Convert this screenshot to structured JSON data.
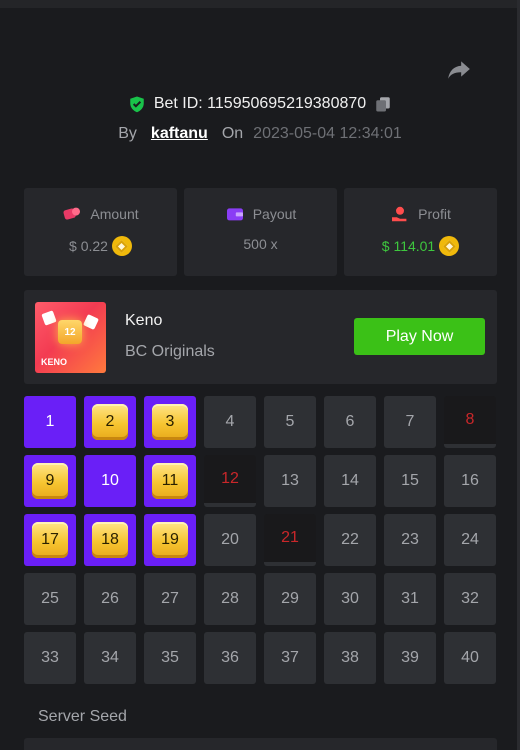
{
  "bet": {
    "id_label": "Bet ID: 115950695219380870",
    "by_label": "By",
    "username": "kaftanu",
    "on_label": "On",
    "datetime": "2023-05-04 12:34:01"
  },
  "stats": {
    "amount": {
      "label": "Amount",
      "value": "$ 0.22",
      "icon": "money-bag-icon"
    },
    "payout": {
      "label": "Payout",
      "value": "500 x",
      "icon": "wallet-icon"
    },
    "profit": {
      "label": "Profit",
      "value": "$ 114.01",
      "icon": "hand-coin-icon"
    }
  },
  "game": {
    "name": "Keno",
    "provider": "BC Originals",
    "thumb_label": "KENO",
    "thumb_number": "12",
    "play_label": "Play Now"
  },
  "grid": {
    "cells": [
      {
        "n": "1",
        "state": "sel"
      },
      {
        "n": "2",
        "state": "hit"
      },
      {
        "n": "3",
        "state": "hit"
      },
      {
        "n": "4",
        "state": "none"
      },
      {
        "n": "5",
        "state": "none"
      },
      {
        "n": "6",
        "state": "none"
      },
      {
        "n": "7",
        "state": "none"
      },
      {
        "n": "8",
        "state": "miss"
      },
      {
        "n": "9",
        "state": "hit"
      },
      {
        "n": "10",
        "state": "sel"
      },
      {
        "n": "11",
        "state": "hit"
      },
      {
        "n": "12",
        "state": "miss"
      },
      {
        "n": "13",
        "state": "none"
      },
      {
        "n": "14",
        "state": "none"
      },
      {
        "n": "15",
        "state": "none"
      },
      {
        "n": "16",
        "state": "none"
      },
      {
        "n": "17",
        "state": "hit"
      },
      {
        "n": "18",
        "state": "hit"
      },
      {
        "n": "19",
        "state": "hit"
      },
      {
        "n": "20",
        "state": "none"
      },
      {
        "n": "21",
        "state": "miss"
      },
      {
        "n": "22",
        "state": "none"
      },
      {
        "n": "23",
        "state": "none"
      },
      {
        "n": "24",
        "state": "none"
      },
      {
        "n": "25",
        "state": "none"
      },
      {
        "n": "26",
        "state": "none"
      },
      {
        "n": "27",
        "state": "none"
      },
      {
        "n": "28",
        "state": "none"
      },
      {
        "n": "29",
        "state": "none"
      },
      {
        "n": "30",
        "state": "none"
      },
      {
        "n": "31",
        "state": "none"
      },
      {
        "n": "32",
        "state": "none"
      },
      {
        "n": "33",
        "state": "none"
      },
      {
        "n": "34",
        "state": "none"
      },
      {
        "n": "35",
        "state": "none"
      },
      {
        "n": "36",
        "state": "none"
      },
      {
        "n": "37",
        "state": "none"
      },
      {
        "n": "38",
        "state": "none"
      },
      {
        "n": "39",
        "state": "none"
      },
      {
        "n": "40",
        "state": "none"
      }
    ]
  },
  "seed": {
    "label": "Server Seed"
  },
  "colors": {
    "accent_green": "#3bc117",
    "selected_purple": "#6a1ff7",
    "verified_green": "#19c24a",
    "miss_red": "#c9272a"
  }
}
